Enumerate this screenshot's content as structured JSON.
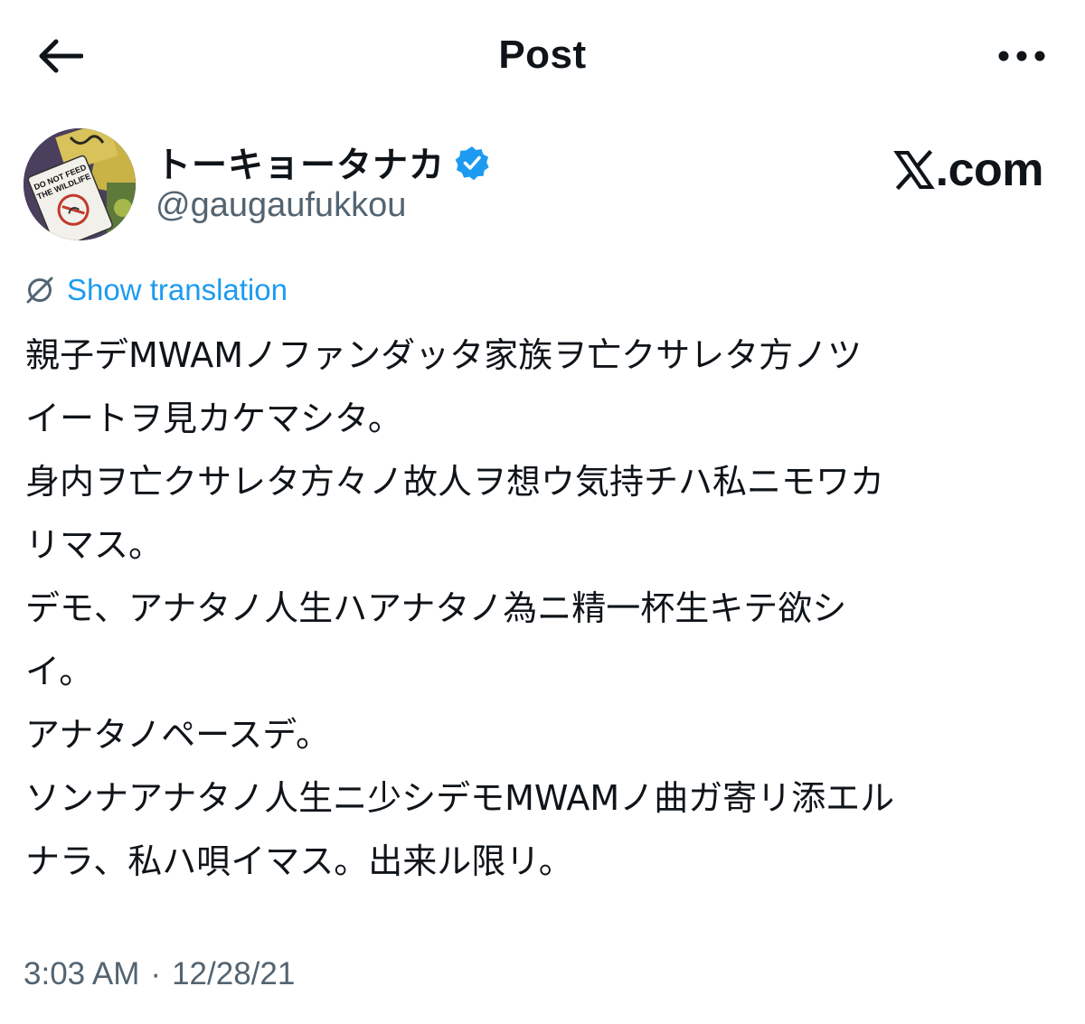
{
  "header": {
    "title": "Post",
    "back_icon": "arrow-left-icon",
    "more_icon": "more-horizontal-icon"
  },
  "author": {
    "display_name": "トーキョータナカ",
    "handle": "@gaugaufukkou",
    "verified": true,
    "verified_color": "#1d9bf0",
    "avatar_text": [
      "DO NOT FEED",
      "THE WILDLIFE"
    ]
  },
  "watermark": {
    "brand_suffix": ".com"
  },
  "translation": {
    "label": "Show translation",
    "icon": "translate-icon",
    "color": "#1d9bf0"
  },
  "tweet": {
    "lines": [
      "親子デMWAMノファンダッタ家族ヲ亡クサレタ方ノツ",
      "イートヲ見カケマシタ。",
      "身内ヲ亡クサレタ方々ノ故人ヲ想ウ気持チハ私ニモワカ",
      "リマス。",
      "デモ、アナタノ人生ハアナタノ為ニ精一杯生キテ欲シ",
      "イ。",
      "アナタノペースデ。",
      "ソンナアナタノ人生ニ少シデモMWAMノ曲ガ寄リ添エル",
      "ナラ、私ハ唄イマス。出来ル限リ。"
    ]
  },
  "meta": {
    "time": "3:03 AM",
    "separator": "·",
    "date": "12/28/21"
  }
}
